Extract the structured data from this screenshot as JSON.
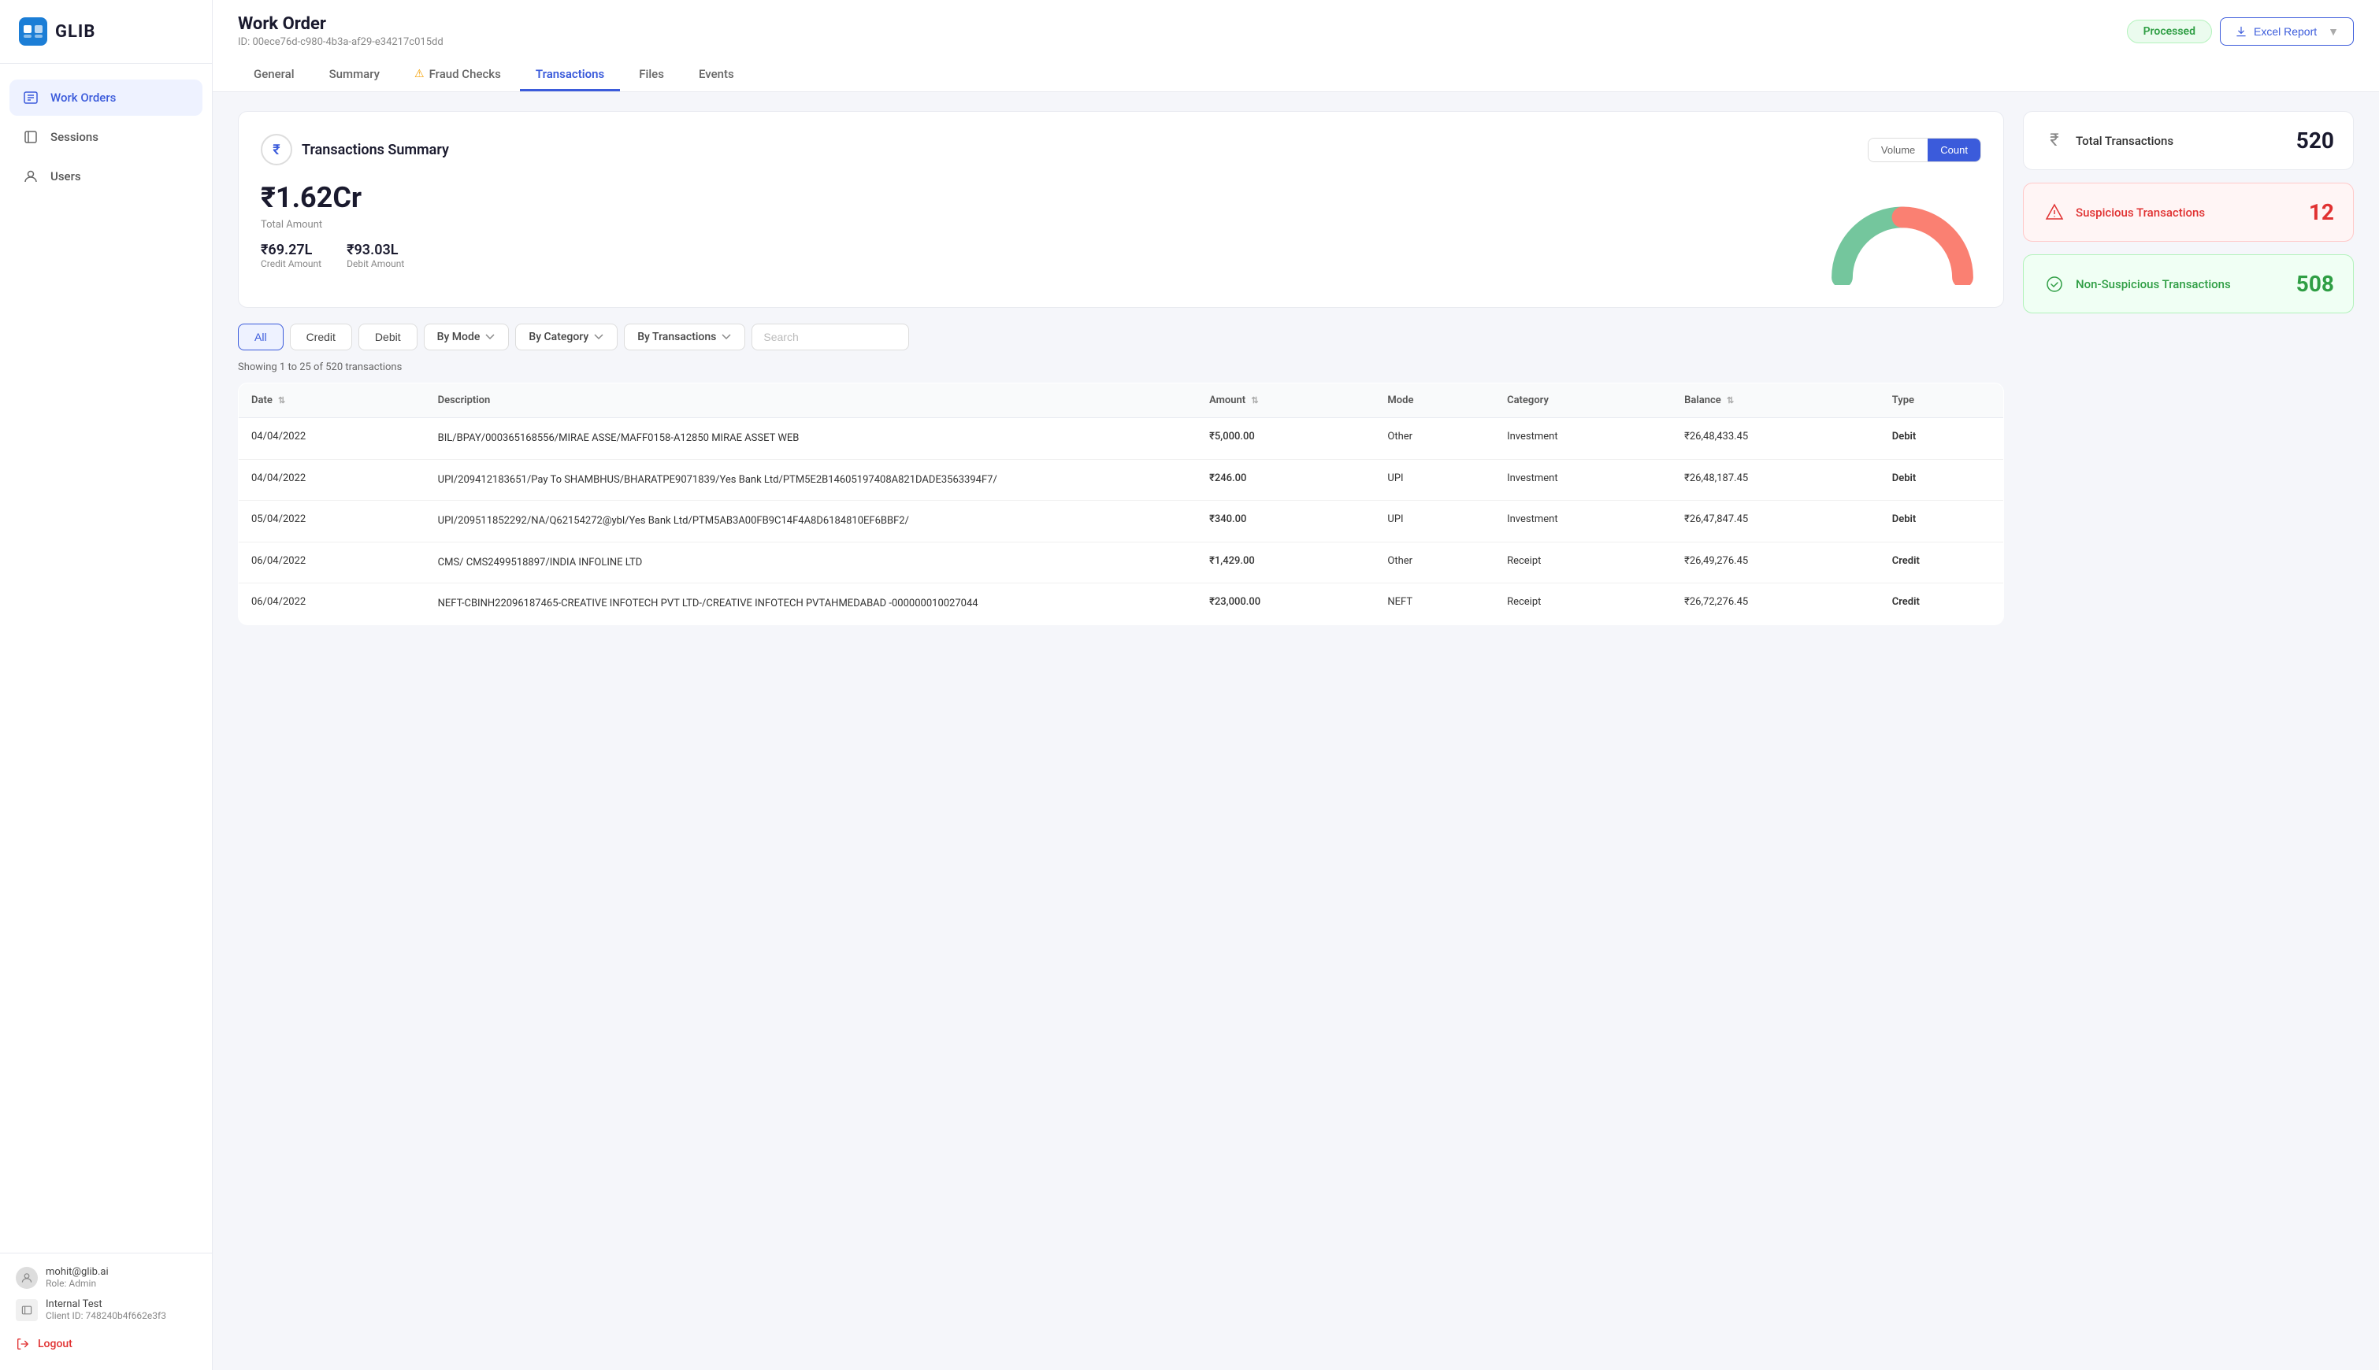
{
  "sidebar": {
    "logo_text": "GLIB",
    "nav_items": [
      {
        "id": "work-orders",
        "label": "Work Orders",
        "active": true
      },
      {
        "id": "sessions",
        "label": "Sessions",
        "active": false
      },
      {
        "id": "users",
        "label": "Users",
        "active": false
      }
    ],
    "footer": {
      "user_email": "mohit@glib.ai",
      "user_role": "Role: Admin",
      "client_name": "Internal Test",
      "client_id": "Client ID: 748240b4f662e3f3",
      "logout_label": "Logout"
    }
  },
  "header": {
    "title": "Work Order",
    "id_label": "ID: 00ece76d-c980-4b3a-af29-e34217c015dd",
    "status_badge": "Processed",
    "tabs": [
      {
        "id": "general",
        "label": "General",
        "active": false,
        "has_warning": false
      },
      {
        "id": "summary",
        "label": "Summary",
        "active": false,
        "has_warning": false
      },
      {
        "id": "fraud-checks",
        "label": "Fraud Checks",
        "active": false,
        "has_warning": true
      },
      {
        "id": "transactions",
        "label": "Transactions",
        "active": true,
        "has_warning": false
      },
      {
        "id": "files",
        "label": "Files",
        "active": false,
        "has_warning": false
      },
      {
        "id": "events",
        "label": "Events",
        "active": false,
        "has_warning": false
      }
    ],
    "excel_btn_label": "Excel Report"
  },
  "summary_card": {
    "title": "Transactions Summary",
    "toggle_volume": "Volume",
    "toggle_count": "Count",
    "total_amount": "₹1.62Cr",
    "total_label": "Total Amount",
    "credit_amount": "₹69.27L",
    "credit_label": "Credit Amount",
    "debit_amount": "₹93.03L",
    "debit_label": "Debit Amount",
    "gauge": {
      "credit_pct": 43,
      "debit_pct": 57
    }
  },
  "stats": {
    "total_label": "Total Transactions",
    "total_value": "520",
    "suspicious_label": "Suspicious Transactions",
    "suspicious_value": "12",
    "non_suspicious_label": "Non-Suspicious Transactions",
    "non_suspicious_value": "508"
  },
  "filters": {
    "all_label": "All",
    "credit_label": "Credit",
    "debit_label": "Debit",
    "by_mode_label": "By Mode",
    "by_category_label": "By Category",
    "by_transactions_label": "By Transactions",
    "search_placeholder": "Search"
  },
  "table": {
    "showing_text": "Showing 1 to 25 of 520 transactions",
    "columns": [
      "Date",
      "Description",
      "Amount",
      "Mode",
      "Category",
      "Balance",
      "Type"
    ],
    "rows": [
      {
        "date": "04/04/2022",
        "description": "BIL/BPAY/000365168556/MIRAE ASSE/MAFF0158-A12850 MIRAE ASSET WEB",
        "amount": "₹5,000.00",
        "mode": "Other",
        "category": "Investment",
        "balance": "₹26,48,433.45",
        "type": "Debit"
      },
      {
        "date": "04/04/2022",
        "description": "UPI/209412183651/Pay To SHAMBHUS/BHARATPE9071839/Yes Bank Ltd/PTM5E2B14605197408A821DADE3563394F7/",
        "amount": "₹246.00",
        "mode": "UPI",
        "category": "Investment",
        "balance": "₹26,48,187.45",
        "type": "Debit"
      },
      {
        "date": "05/04/2022",
        "description": "UPI/209511852292/NA/Q62154272@ybl/Yes Bank Ltd/PTM5AB3A00FB9C14F4A8D6184810EF6BBF2/",
        "amount": "₹340.00",
        "mode": "UPI",
        "category": "Investment",
        "balance": "₹26,47,847.45",
        "type": "Debit"
      },
      {
        "date": "06/04/2022",
        "description": "CMS/ CMS2499518897/INDIA INFOLINE LTD",
        "amount": "₹1,429.00",
        "mode": "Other",
        "category": "Receipt",
        "balance": "₹26,49,276.45",
        "type": "Credit"
      },
      {
        "date": "06/04/2022",
        "description": "NEFT-CBINH22096187465-CREATIVE INFOTECH PVT LTD-/CREATIVE INFOTECH PVTAHMEDABAD -000000010027044",
        "amount": "₹23,000.00",
        "mode": "NEFT",
        "category": "Receipt",
        "balance": "₹26,72,276.45",
        "type": "Credit"
      }
    ]
  }
}
